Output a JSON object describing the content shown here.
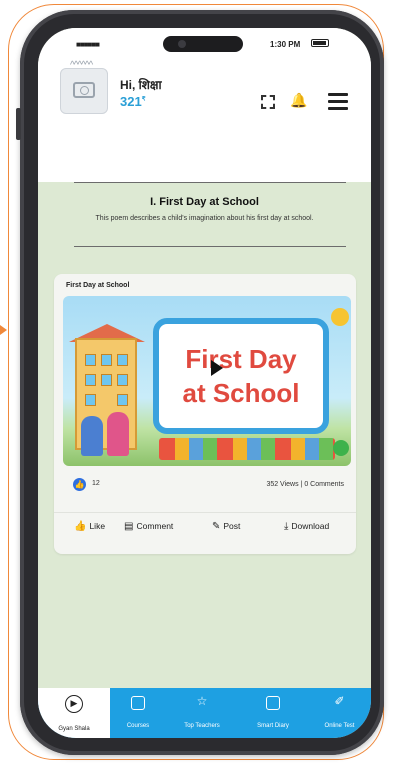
{
  "status_bar": {
    "time": "1:30 PM"
  },
  "header": {
    "greeting": "Hi, शिक्षा",
    "points": "321"
  },
  "lesson": {
    "title": "I. First Day at School",
    "description": "This poem describes a child's imagination about his first day at school."
  },
  "video_card": {
    "label": "First Day at School",
    "thumbnail_text_line1": "First Day",
    "thumbnail_text_line2": "at School",
    "likes": "12",
    "stats": "352 Views | 0 Comments",
    "actions": [
      "Like",
      "Comment",
      "Post",
      "Download"
    ]
  },
  "bottom_nav": [
    {
      "label": "Gyan Shala",
      "icon": "play-circle-icon",
      "active": true
    },
    {
      "label": "Courses",
      "icon": "book-icon"
    },
    {
      "label": "Top Teachers",
      "icon": "trophy-icon"
    },
    {
      "label": "Smart Diary",
      "icon": "diary-icon"
    },
    {
      "label": "Online Test",
      "icon": "pencil-paper-icon"
    }
  ],
  "colors": {
    "accent": "#1ea0e2",
    "page_background": "#dde9d3",
    "outline": "#f0883a",
    "points": "#2a9fd6"
  }
}
